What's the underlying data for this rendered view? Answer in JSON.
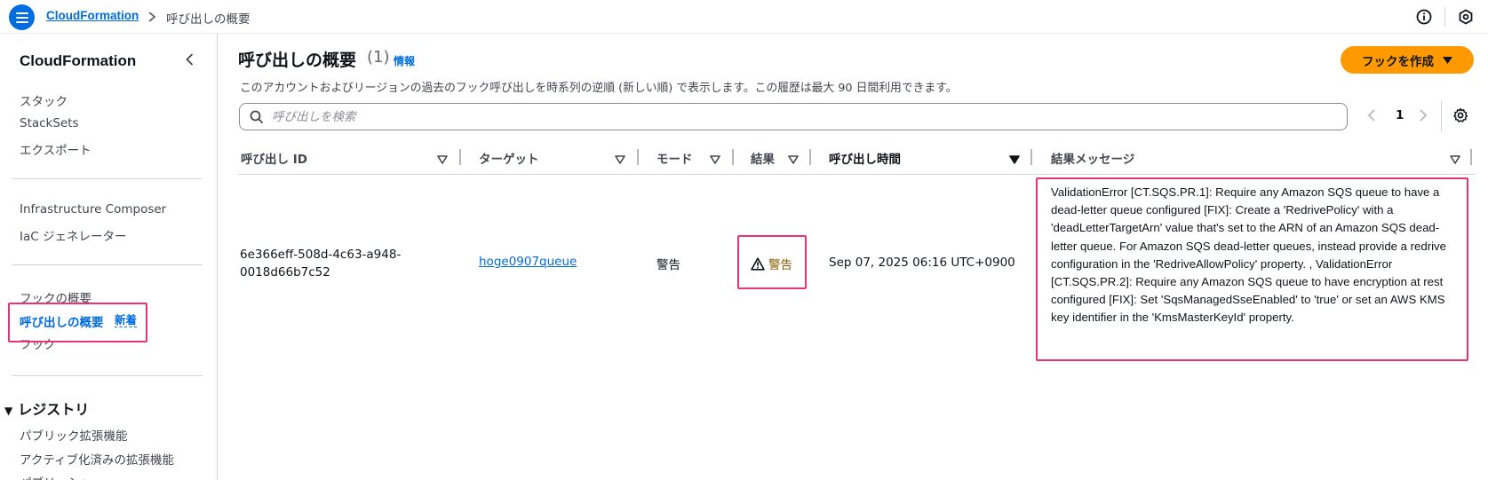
{
  "topbar": {
    "breadcrumb_root": "CloudFormation",
    "breadcrumb_current": "呼び出しの概要",
    "icons": [
      "menu-icon",
      "chevron-right-icon",
      "info-circle-icon",
      "hexagon-settings-icon"
    ]
  },
  "sidebar": {
    "title": "CloudFormation",
    "items": [
      {
        "label": "スタック"
      },
      {
        "label": "StackSets"
      },
      {
        "label": "エクスポート"
      },
      {
        "label": "Infrastructure Composer"
      },
      {
        "label": "IaC ジェネレーター"
      },
      {
        "label": "フックの概要"
      },
      {
        "label": "呼び出しの概要",
        "active": true,
        "badge": "新着"
      },
      {
        "label": "フック"
      }
    ],
    "registry": {
      "label": "レジストリ",
      "items": [
        {
          "label": "パブリック拡張機能"
        },
        {
          "label": "アクティブ化済みの拡張機能"
        },
        {
          "label": "パブリッシャー"
        }
      ]
    }
  },
  "main": {
    "title": "呼び出しの概要",
    "count": "(1)",
    "info_link": "情報",
    "description": "このアカウントおよびリージョンの過去のフック呼び出しを時系列の逆順 (新しい順) で表示します。この履歴は最大 90 日間利用できます。",
    "create_button": "フックを作成",
    "search_placeholder": "呼び出しを検索",
    "pagination": {
      "current_page": "1"
    },
    "columns": [
      "呼び出し ID",
      "ターゲット",
      "モード",
      "結果",
      "呼び出し時間",
      "結果メッセージ"
    ],
    "rows": [
      {
        "id": "6e366eff-508d-4c63-a948-0018d66b7c52",
        "target": "hoge0907queue",
        "mode": "警告",
        "result": "警告",
        "time": "Sep 07, 2025 06:16 UTC+0900",
        "message": "ValidationError [CT.SQS.PR.1]: Require any Amazon SQS queue to have a dead-letter queue configured [FIX]: Create a 'RedrivePolicy' with a 'deadLetterTargetArn' value that's set to the ARN of an Amazon SQS dead-letter queue. For Amazon SQS dead-letter queues, instead provide a redrive configuration in the 'RedriveAllowPolicy' property. , ValidationError [CT.SQS.PR.2]: Require any Amazon SQS queue to have encryption at rest configured [FIX]: Set 'SqsManagedSseEnabled' to 'true' or set an AWS KMS key identifier in the 'KmsMasterKeyId' property."
      }
    ]
  },
  "colors": {
    "link_blue": "#006ce0",
    "create_orange": "#ff9900",
    "warning_text": "#855900",
    "highlight_pink": "#e9327a"
  }
}
